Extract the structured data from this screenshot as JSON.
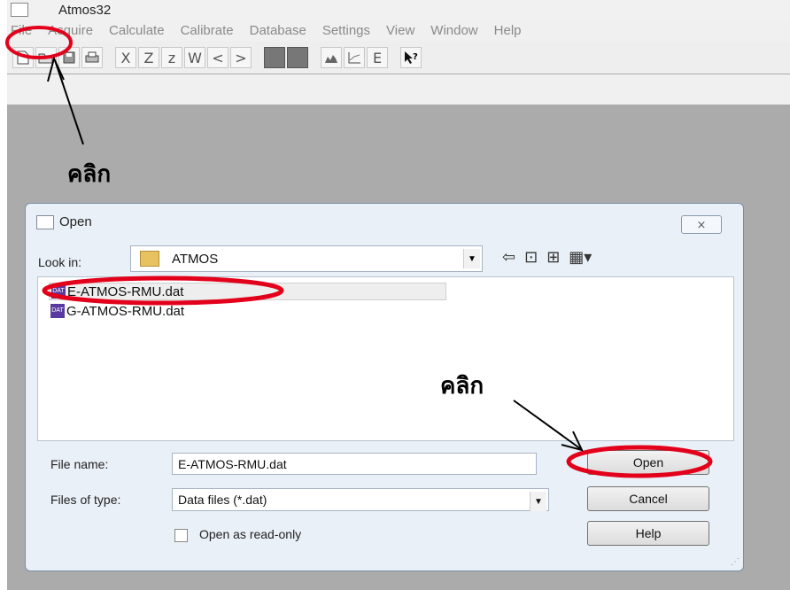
{
  "app": {
    "title": "Atmos32",
    "menu": [
      "File",
      "Acquire",
      "Calculate",
      "Calibrate",
      "Database",
      "Settings",
      "View",
      "Window",
      "Help"
    ]
  },
  "toolbar": {
    "icons": [
      "new-icon",
      "open-icon",
      "save-icon",
      "print-icon",
      "x-icon",
      "z-icon",
      "z-small-icon",
      "w-icon",
      "prev-icon",
      "next-icon",
      "block-icon",
      "block-icon",
      "chart-icon",
      "axes-icon",
      "e-icon",
      "help-pointer-icon"
    ],
    "letters": {
      "x": "X",
      "z": "Z",
      "z_small": "z",
      "w": "W",
      "prev": "<",
      "next": ">",
      "e": "E"
    }
  },
  "annotations": {
    "click_text_1": "คลิก",
    "click_text_2": "คลิก",
    "highlight_color": "#e3001b"
  },
  "dialog": {
    "title": "Open",
    "close": "⨯",
    "look_in_label": "Look in:",
    "look_in_value": "ATMOS",
    "files": [
      {
        "name": "E-ATMOS-RMU.dat",
        "selected": true
      },
      {
        "name": "G-ATMOS-RMU.dat",
        "selected": false
      }
    ],
    "file_name_label": "File name:",
    "file_name_value": "E-ATMOS-RMU.dat",
    "file_type_label": "Files of type:",
    "file_type_value": "Data files (*.dat)",
    "read_only_label": "Open as read-only",
    "buttons": {
      "open": "Open",
      "cancel": "Cancel",
      "help": "Help"
    }
  }
}
